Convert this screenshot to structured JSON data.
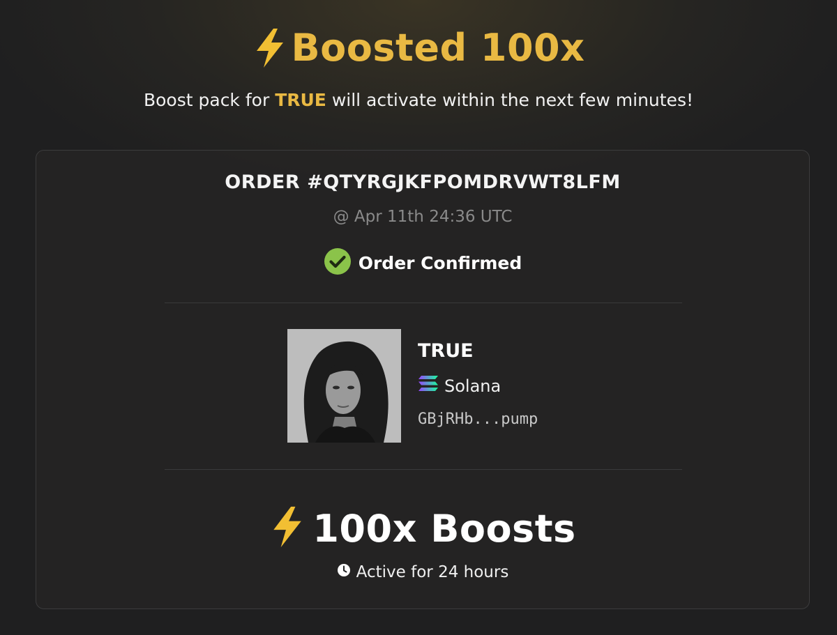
{
  "hero": {
    "icon": "lightning-bolt-icon",
    "title": "Boosted 100x",
    "subtitle_before": "Boost pack for ",
    "subtitle_token": "TRUE",
    "subtitle_after": " will activate within the next few minutes!"
  },
  "order": {
    "id": "ORDER #QTYRGJKFPOMDRVWT8LFM",
    "timestamp": "@ Apr 11th 24:36 UTC",
    "status_icon": "check-circle-icon",
    "status": "Order Confirmed"
  },
  "token": {
    "avatar": "token-avatar-photo",
    "name": "TRUE",
    "chain_icon": "solana-logo-icon",
    "chain": "Solana",
    "address": "GBjRHb...pump"
  },
  "boost": {
    "icon": "lightning-bolt-icon",
    "amount_label": "100x Boosts",
    "duration_icon": "clock-icon",
    "duration": "Active for 24 hours"
  },
  "colors": {
    "accent": "#e9b943",
    "success": "#8bc34a",
    "background": "#222223",
    "card_border": "#3c3c3d"
  }
}
